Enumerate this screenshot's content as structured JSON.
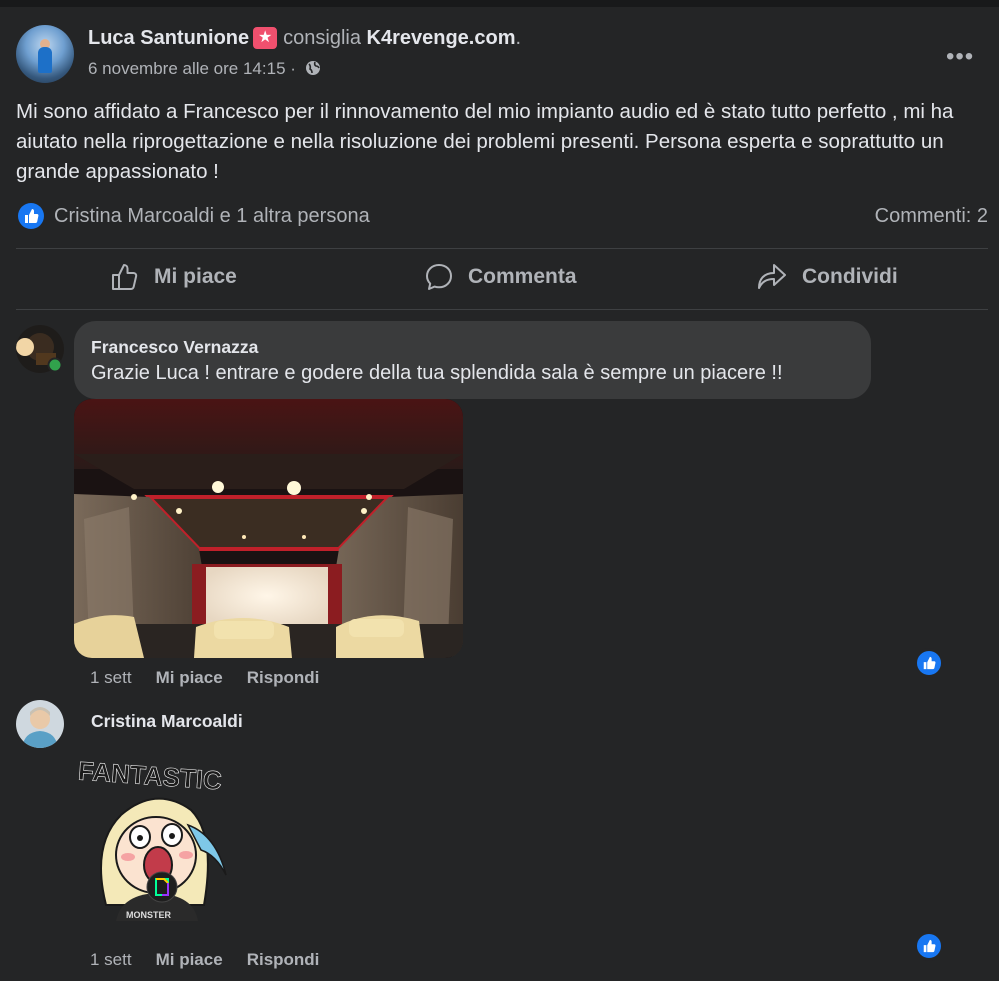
{
  "post": {
    "author": "Luca Santunione",
    "recommends_text": "consiglia",
    "page_name": "K4revenge.com",
    "page_suffix": ".",
    "timestamp": "6 novembre alle ore 14:15",
    "meta_separator": "·",
    "body": "Mi sono affidato a Francesco per il rinnovamento del mio impianto audio ed è stato tutto perfetto , mi ha aiutato nella riprogettazione e nella risoluzione dei problemi presenti. Persona esperta e soprattutto un grande appassionato !",
    "reactions_text": "Cristina Marcoaldi e 1 altra persona",
    "comments_count_text": "Commenti: 2",
    "more_label": "•••"
  },
  "actions": {
    "like": "Mi piace",
    "comment": "Commenta",
    "share": "Condividi"
  },
  "comments": [
    {
      "author": "Francesco Vernazza",
      "text": "Grazie Luca ! entrare e godere della tua splendida sala è sempre un piacere !!",
      "time": "1 sett",
      "like_label": "Mi piace",
      "reply_label": "Rispondi"
    },
    {
      "author": "Cristina Marcoaldi",
      "sticker_text": "FANTASTIC",
      "sticker_shirt_text": "MONSTER",
      "time": "1 sett",
      "like_label": "Mi piace",
      "reply_label": "Rispondi"
    }
  ],
  "colors": {
    "background": "#242526",
    "bubble": "#3a3b3c",
    "accent": "#1877f2",
    "online": "#31a24c"
  }
}
